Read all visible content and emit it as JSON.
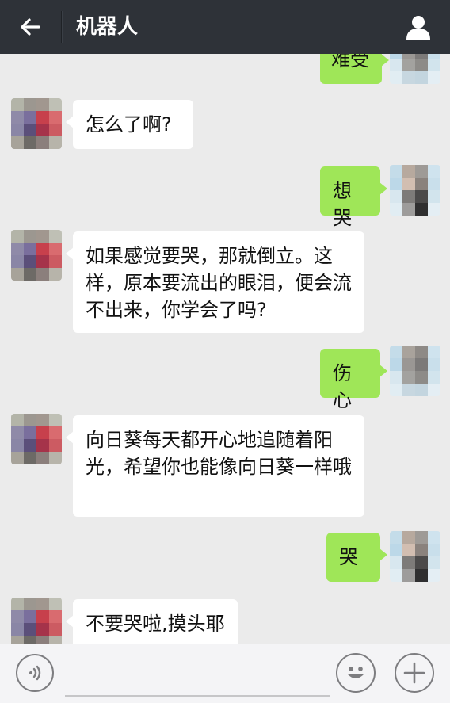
{
  "header": {
    "title": "机器人",
    "back_icon": "arrow-left-icon",
    "profile_icon": "person-icon"
  },
  "messages": [
    {
      "side": "right",
      "text": "难受"
    },
    {
      "side": "left",
      "text": "怎么了啊?"
    },
    {
      "side": "right",
      "text": "想哭"
    },
    {
      "side": "left",
      "text": "如果感觉要哭，那就倒立。这样，原本要流出的眼泪，便会流不出来，你学会了吗?"
    },
    {
      "side": "right",
      "text": "伤心"
    },
    {
      "side": "left",
      "text": "向日葵每天都开心地追随着阳光，希望你也能像向日葵一样哦"
    },
    {
      "side": "right",
      "text": "哭"
    },
    {
      "side": "left",
      "text": "不要哭啦,摸头耶"
    }
  ],
  "input_bar": {
    "voice_icon": "voice-icon",
    "emoji_icon": "emoji-icon",
    "add_icon": "plus-icon",
    "input_value": "",
    "input_placeholder": ""
  },
  "colors": {
    "titlebar": "#2e3238",
    "background": "#ebebeb",
    "bubble_self": "#9fe658",
    "bubble_other": "#ffffff"
  }
}
